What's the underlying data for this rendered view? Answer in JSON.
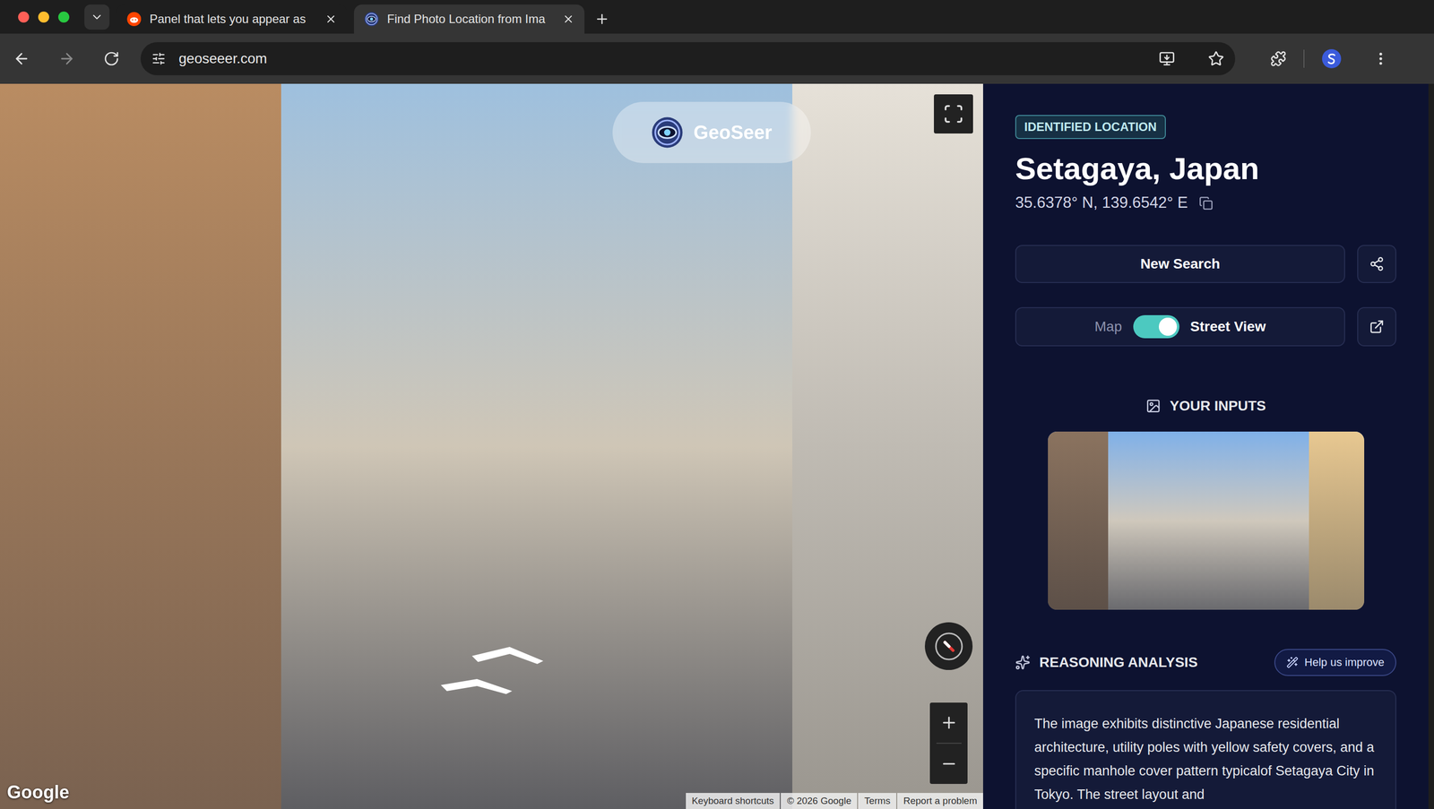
{
  "browser": {
    "tabs": [
      {
        "label": "Panel that lets you appear as",
        "selected": false,
        "favicon": "reddit"
      },
      {
        "label": "Find Photo Location from Ima",
        "selected": true,
        "favicon": "geoseer"
      }
    ],
    "url": "geoseeer.com"
  },
  "street_view": {
    "brand": "GeoSeer",
    "provider": "Google",
    "footer_links": [
      "Keyboard shortcuts",
      "© 2026 Google",
      "Terms",
      "Report a problem"
    ]
  },
  "panel": {
    "badge": "IDENTIFIED LOCATION",
    "location": "Setagaya, Japan",
    "coordinates": "35.6378° N, 139.6542° E",
    "new_search": "New Search",
    "view_toggle": {
      "left": "Map",
      "right": "Street View",
      "on": true
    },
    "inputs_title": "YOUR INPUTS",
    "reasoning_title": "REASONING ANALYSIS",
    "feedback_button": "Help us improve",
    "reasoning_text": "The image exhibits distinctive Japanese residential architecture, utility poles with yellow safety covers, and a specific manhole cover pattern typicalof Setagaya City in Tokyo. The street layout and"
  }
}
